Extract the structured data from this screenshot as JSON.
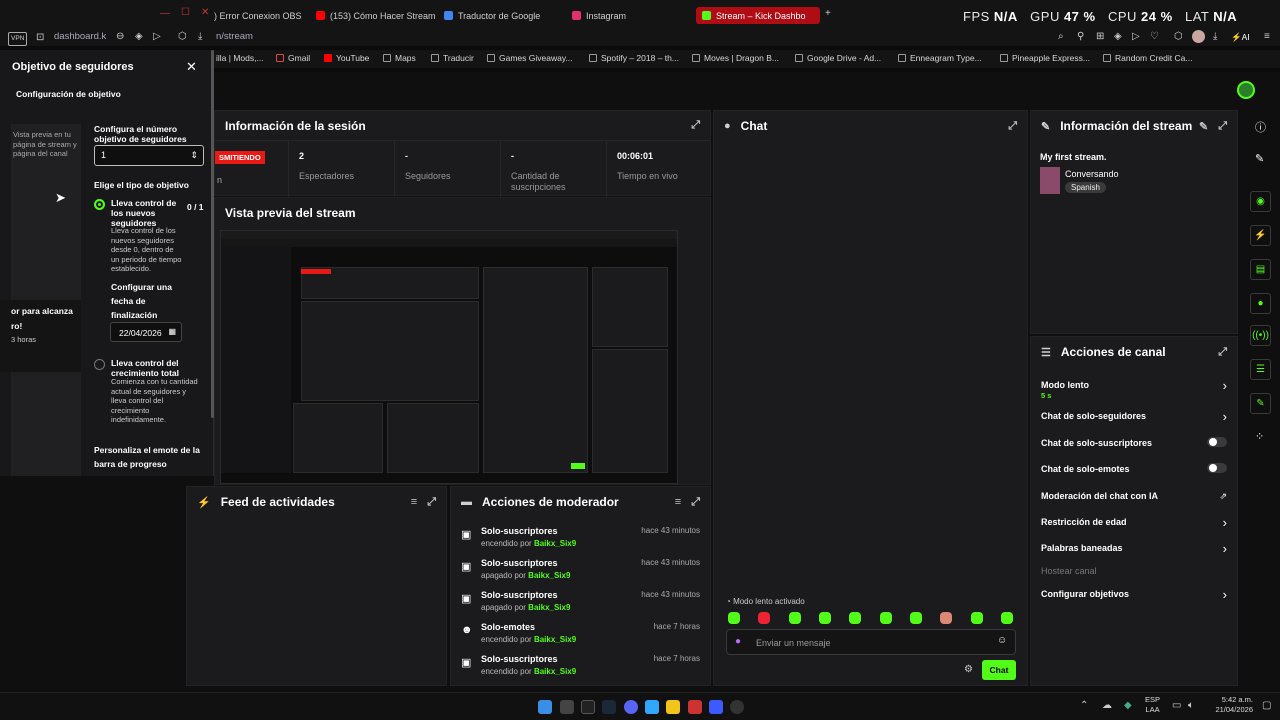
{
  "browser": {
    "tabs": [
      {
        "label": ") Error Conexion OBS",
        "color": "#e9452a"
      },
      {
        "label": "(153) Cómo Hacer Stream",
        "color": "#ff0000"
      },
      {
        "label": "Traductor de Google",
        "color": "#4285f4"
      },
      {
        "label": "Instagram",
        "color": "#e1306c"
      },
      {
        "label": "Stream – Kick Dashbo",
        "color": "#53fc18"
      }
    ],
    "new_tab": "+",
    "url": "dashboard.k",
    "url_tail": "n/stream",
    "vpn": "VPN",
    "ai": "AI",
    "stats": {
      "fps_label": "FPS",
      "fps": "N/A",
      "gpu_label": "GPU",
      "gpu": "47 %",
      "cpu_label": "CPU",
      "cpu": "24 %",
      "lat_label": "LAT",
      "lat": "N/A"
    },
    "bookmarks": [
      "illa | Mods,...",
      "Gmail",
      "YouTube",
      "Maps",
      "Traducir",
      "Games Giveaway...",
      "Spotify – 2018 – th...",
      "Moves | Dragon B...",
      "Google Drive - Ad...",
      "Enneagram Type...",
      "Pineapple Express...",
      "Random Credit Ca..."
    ]
  },
  "modal": {
    "title": "Objetivo de seguidores",
    "subtitle": "Configuración de objetivo",
    "preview_text": "Vista previa en tu página de stream y página del canal",
    "preview_goal_line1": "or para alcanza",
    "preview_goal_line2": "ro!",
    "preview_goal_line3": "3 horas",
    "number_label": "Configura el número objetivo de seguidores",
    "number_value": "1",
    "type_label": "Elige el tipo de objetivo",
    "option1_title": "Lleva control de los nuevos seguidores",
    "option1_count": "0 / 1",
    "option1_desc": "Lleva control de los nuevos seguidores desde 0, dentro de un periodo de tiempo establecido.",
    "date_label": "Configurar una fecha de finalización",
    "date_value": "22/04/2026",
    "option2_title": "Lleva control del crecimiento total",
    "option2_desc": "Comienza con tu cantidad actual de seguidores y lleva control del crecimiento indefinidamente.",
    "emote_label": "Personaliza el emote de la barra de progreso"
  },
  "session": {
    "title": "Información de la sesión",
    "live_badge": "SMITIENDO",
    "live_sub": "n",
    "stats": [
      {
        "value": "2",
        "label": "Espectadores"
      },
      {
        "value": "-",
        "label": "Seguidores"
      },
      {
        "value": "-",
        "label": "Cantidad de suscripciones"
      },
      {
        "value": "00:06:01",
        "label": "Tiempo en vivo"
      }
    ]
  },
  "preview": {
    "title": "Vista previa del stream"
  },
  "chat": {
    "title": "Chat",
    "slow_mode": "Modo lento activado",
    "placeholder": "Enviar un mensaje",
    "send": "Chat"
  },
  "stream_info": {
    "title": "Información del stream",
    "stream_title": "My first stream.",
    "category": "Conversando",
    "language": "Spanish"
  },
  "channel_actions": {
    "title": "Acciones de canal",
    "slow_mode": "Modo lento",
    "slow_mode_value": "5 s",
    "followers_only": "Chat de solo-seguidores",
    "subs_only": "Chat de solo-suscriptores",
    "emotes_only": "Chat de solo-emotes",
    "ai_mod": "Moderación del chat con IA",
    "age": "Restricción de edad",
    "banned": "Palabras baneadas",
    "host": "Hostear canal",
    "goals": "Configurar objetivos"
  },
  "activity": {
    "title": "Feed de actividades"
  },
  "mod_actions": {
    "title": "Acciones de moderador",
    "items": [
      {
        "title": "Solo-suscriptores",
        "action": "encendido por",
        "user": "Baikx_Six9",
        "time": "hace 43 minutos"
      },
      {
        "title": "Solo-suscriptores",
        "action": "apagado por",
        "user": "Baikx_Six9",
        "time": "hace 43 minutos"
      },
      {
        "title": "Solo-suscriptores",
        "action": "apagado por",
        "user": "Baikx_Six9",
        "time": "hace 43 minutos"
      },
      {
        "title": "Solo-emotes",
        "action": "encendido por",
        "user": "Baikx_Six9",
        "time": "hace 7 horas"
      },
      {
        "title": "Solo-suscriptores",
        "action": "encendido por",
        "user": "Baikx_Six9",
        "time": "hace 7 horas"
      }
    ]
  },
  "taskbar": {
    "lang1": "ESP",
    "lang2": "LAA",
    "time": "5:42 a.m.",
    "date": "21/04/2026"
  },
  "colors": {
    "accent": "#53fc18",
    "live": "#e91916"
  }
}
